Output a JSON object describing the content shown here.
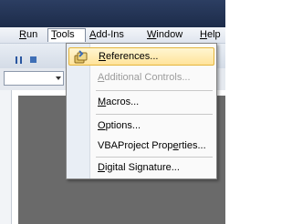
{
  "menubar": {
    "items": [
      {
        "pre": "",
        "acc": "R",
        "post": "un"
      },
      {
        "pre": "",
        "acc": "T",
        "post": "ools"
      },
      {
        "pre": "",
        "acc": "A",
        "post": "dd-Ins"
      },
      {
        "pre": "",
        "acc": "W",
        "post": "indow"
      },
      {
        "pre": "",
        "acc": "H",
        "post": "elp"
      }
    ]
  },
  "tools_menu": {
    "items": [
      {
        "pre": "",
        "acc": "R",
        "post": "eferences...",
        "enabled": true,
        "highlighted": true,
        "icon": "references-icon"
      },
      {
        "pre": "",
        "acc": "A",
        "post": "dditional Controls...",
        "enabled": false
      },
      {
        "pre": "",
        "acc": "M",
        "post": "acros...",
        "enabled": true
      },
      {
        "pre": "",
        "acc": "O",
        "post": "ptions...",
        "enabled": true
      },
      {
        "pre": "VBAProject Prop",
        "acc": "e",
        "post": "rties...",
        "enabled": true
      },
      {
        "pre": "",
        "acc": "D",
        "post": "igital Signature...",
        "enabled": true
      }
    ]
  },
  "colors": {
    "highlight": "#ffe39a",
    "highlight_border": "#e5b53b",
    "disabled_text": "#9c9c9c",
    "titlebar": "#1d2c4a"
  }
}
